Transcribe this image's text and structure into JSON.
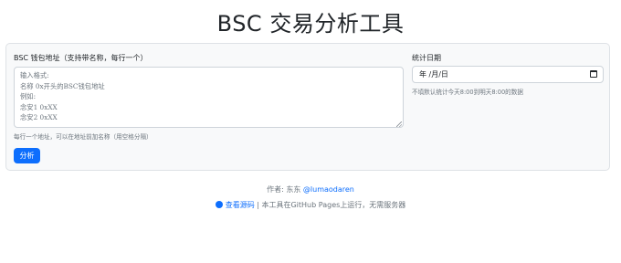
{
  "page": {
    "title": "BSC 交易分析工具"
  },
  "form": {
    "address_label": "BSC 钱包地址（支持带名称，每行一个）",
    "address_placeholder": "输入格式:\n名称 0x开头的BSC钱包地址\n例如:\n念安1 0xXX\n念安2 0xXX",
    "address_help": "每行一个地址，可以在地址前加名称（用空格分隔）",
    "date_label": "统计日期",
    "date_value": "年 /月/日",
    "date_help": "不填默认统计今天8:00到明天8:00的数据",
    "analyze_button": "分析"
  },
  "footer": {
    "author_prefix": "作者: 东东",
    "author_handle": "@lumaodaren",
    "source_link": "查看源码",
    "note": "| 本工具在GitHub Pages上运行，无需服务器"
  },
  "icons": {
    "calendar": "calendar-icon",
    "github": "github-icon"
  },
  "colors": {
    "primary": "#0d6efd",
    "muted": "#6c757d",
    "card_bg": "#f8f9fa"
  }
}
